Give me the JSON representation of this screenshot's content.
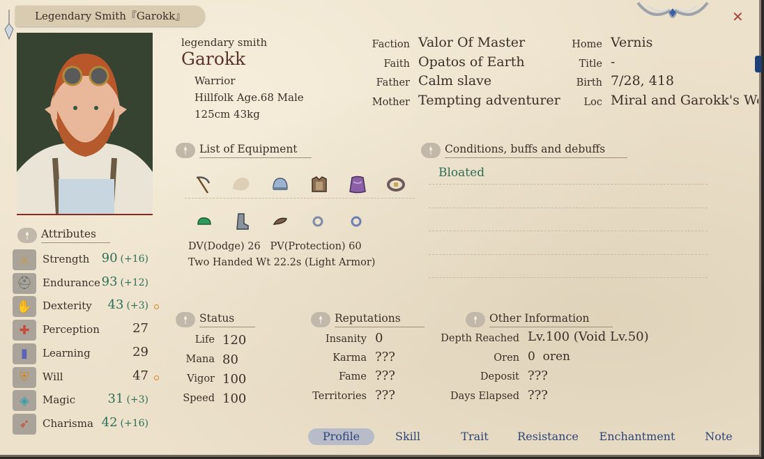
{
  "window": {
    "title": "Legendary Smith『Garokk』",
    "close": "✕"
  },
  "profile": {
    "subtitle": "legendary smith",
    "name": "Garokk",
    "class": "Warrior",
    "race_line": "Hillfolk Age.68 Male",
    "size_line": "125cm 43kg"
  },
  "info_left": [
    {
      "label": "Faction",
      "value": "Valor Of Master"
    },
    {
      "label": "Faith",
      "value": "Opatos of Earth"
    },
    {
      "label": "Father",
      "value": "Calm slave"
    },
    {
      "label": "Mother",
      "value": "Tempting adventurer"
    }
  ],
  "info_right": [
    {
      "label": "Home",
      "value": "Vernis"
    },
    {
      "label": "Title",
      "value": "-"
    },
    {
      "label": "Birth",
      "value": "7/28, 418"
    },
    {
      "label": "Loc",
      "value": "Miral and Garokk's Wo"
    }
  ],
  "equipment": {
    "heading": "List of Equipment",
    "row1_icons": [
      "scythe-icon",
      "empty-slot-icon",
      "helmet-icon",
      "armor-icon",
      "cloak-icon",
      "belt-icon"
    ],
    "row2_icons": [
      "gloves-icon",
      "boots-icon",
      "girdle-icon",
      "ring-icon",
      "ring-icon"
    ],
    "dv_pv": "DV(Dodge) 26   PV(Protection) 60",
    "weight": "Two Handed Wt 22.2s (Light Armor)"
  },
  "conditions": {
    "heading": "Conditions, buffs and debuffs",
    "items": [
      "Bloated"
    ]
  },
  "attributes": {
    "heading": "Attributes",
    "items": [
      {
        "label": "Strength",
        "value": "90",
        "bonus": "(+16)",
        "green": true,
        "dot": false,
        "icon": "sword-icon",
        "color": "#c89b3c"
      },
      {
        "label": "Endurance",
        "value": "93",
        "bonus": "(+12)",
        "green": true,
        "dot": false,
        "icon": "helmet-icon",
        "color": "#6c6c6c"
      },
      {
        "label": "Dexterity",
        "value": "43",
        "bonus": "(+3)",
        "green": true,
        "dot": true,
        "icon": "hand-icon",
        "color": "#d0892a"
      },
      {
        "label": "Perception",
        "value": "27",
        "bonus": "",
        "green": false,
        "dot": false,
        "icon": "crosshair-icon",
        "color": "#c7493c"
      },
      {
        "label": "Learning",
        "value": "29",
        "bonus": "",
        "green": false,
        "dot": false,
        "icon": "book-icon",
        "color": "#5b62b8"
      },
      {
        "label": "Will",
        "value": "47",
        "bonus": "",
        "green": false,
        "dot": true,
        "icon": "shield-icon",
        "color": "#d0892a"
      },
      {
        "label": "Magic",
        "value": "31",
        "bonus": "(+3)",
        "green": true,
        "dot": false,
        "icon": "magic-icon",
        "color": "#3aa0a8"
      },
      {
        "label": "Charisma",
        "value": "42",
        "bonus": "(+16)",
        "green": true,
        "dot": false,
        "icon": "bow-icon",
        "color": "#c74a35"
      }
    ]
  },
  "status": {
    "heading": "Status",
    "items": [
      {
        "label": "Life",
        "value": "120"
      },
      {
        "label": "Mana",
        "value": "80"
      },
      {
        "label": "Vigor",
        "value": "100"
      },
      {
        "label": "Speed",
        "value": "100"
      }
    ]
  },
  "reputations": {
    "heading": "Reputations",
    "items": [
      {
        "label": "Insanity",
        "value": "0"
      },
      {
        "label": "Karma",
        "value": "???"
      },
      {
        "label": "Fame",
        "value": "???"
      },
      {
        "label": "Territories",
        "value": "???"
      }
    ]
  },
  "other": {
    "heading": "Other Information",
    "items": [
      {
        "label": "Depth Reached",
        "value": "Lv.100 (Void Lv.50)"
      },
      {
        "label": "Oren",
        "value": "0  oren"
      },
      {
        "label": "Deposit",
        "value": "???"
      },
      {
        "label": "Days Elapsed",
        "value": "???"
      }
    ]
  },
  "tabs": [
    {
      "label": "Profile",
      "active": true
    },
    {
      "label": "Skill",
      "active": false
    },
    {
      "label": "Trait",
      "active": false
    },
    {
      "label": "Resistance",
      "active": false
    },
    {
      "label": "Enchantment",
      "active": false
    },
    {
      "label": "Note",
      "active": false
    }
  ]
}
